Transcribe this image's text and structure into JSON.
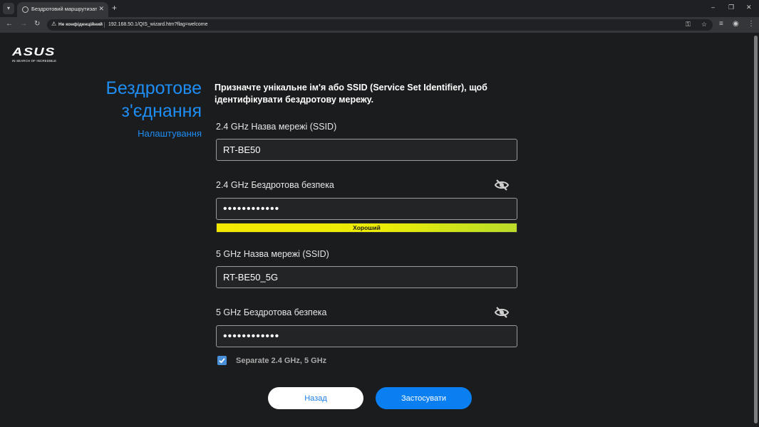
{
  "browser": {
    "tab_title": "Бездротовий маршрутизатор А",
    "new_tab": "+",
    "omnibox": {
      "security_label": "Не конфіденційний",
      "url": "192.168.50.1/QIS_wizard.htm?flag=welcome"
    },
    "window_controls": [
      "–",
      "❐",
      "✕"
    ]
  },
  "logo": {
    "text": "ASUS",
    "tagline": "IN SEARCH OF INCREDIBLE"
  },
  "sidebar": {
    "title_line1": "Бездротове",
    "title_line2": "з'єднання",
    "subtitle": "Налаштування"
  },
  "form": {
    "intro": "Призначте унікальне ім'я або SSID (Service Set Identifier), щоб ідентифікувати бездротову мережу.",
    "ssid_24_label": "2.4 GHz Назва мережі (SSID)",
    "ssid_24_value": "RT-BE50",
    "security_24_label": "2.4 GHz Бездротова безпека",
    "security_24_value": "••••••••••••",
    "strength_label": "Хороший",
    "ssid_5_label": "5 GHz Назва мережі (SSID)",
    "ssid_5_value": "RT-BE50_5G",
    "security_5_label": "5 GHz Бездротова безпека",
    "security_5_value": "••••••••••••",
    "separate_checked": true,
    "separate_label": "Separate 2.4 GHz, 5 GHz"
  },
  "buttons": {
    "back_label": "Назад",
    "apply_label": "Застосувати"
  },
  "colors": {
    "accent": "#1e8ef5",
    "apply_button": "#0a7ff2",
    "background": "#1b1c1e"
  }
}
